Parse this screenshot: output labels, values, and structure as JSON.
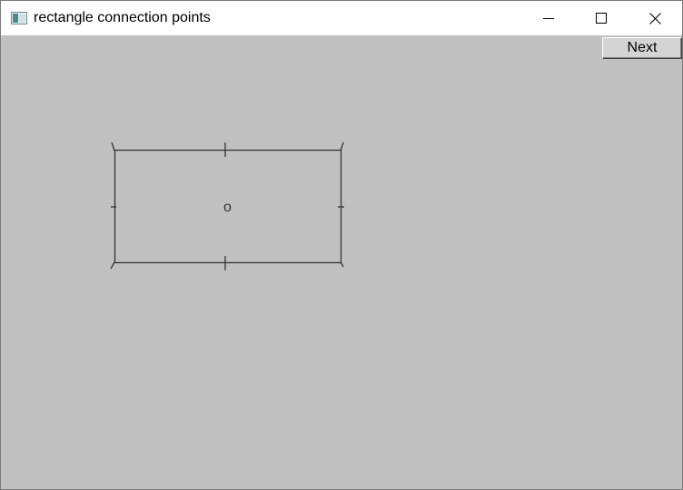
{
  "window": {
    "title": "rectangle connection points",
    "icon": "app-window-icon",
    "controls": [
      "minimize-icon",
      "maximize-icon",
      "close-icon"
    ]
  },
  "toolbar": {
    "next_label": "Next"
  },
  "canvas": {
    "background_color": "#c0c0c0",
    "shape": "rectangle",
    "center_label": "o",
    "stroke_color": "#333333",
    "connection_points": [
      "top-left",
      "top",
      "top-right",
      "right",
      "bottom-right",
      "bottom",
      "bottom-left",
      "left",
      "center"
    ]
  }
}
